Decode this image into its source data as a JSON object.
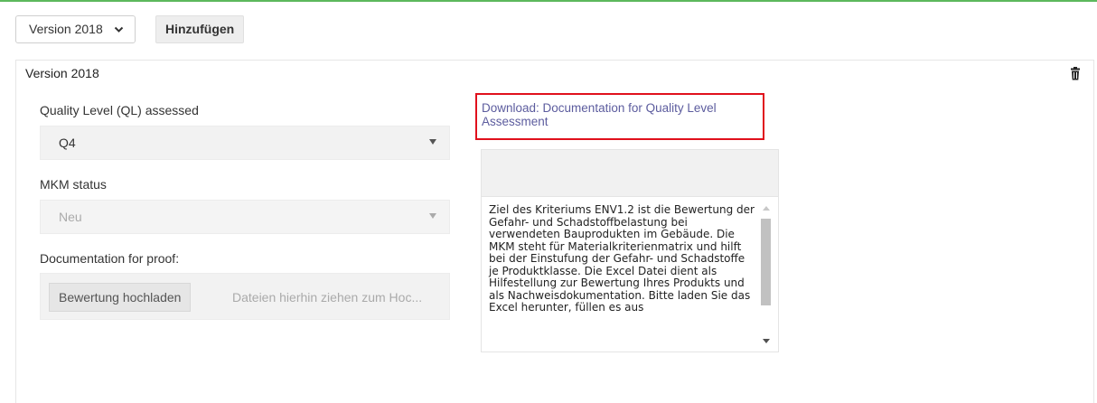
{
  "toolbar": {
    "version_select_value": "Version 2018",
    "add_button_label": "Hinzufügen"
  },
  "panel": {
    "title": "Version 2018",
    "quality_level": {
      "label": "Quality Level (QL) assessed",
      "value": "Q4"
    },
    "mkm_status": {
      "label": "MKM status",
      "value": "Neu"
    },
    "documentation": {
      "label": "Documentation for proof:",
      "upload_button_label": "Bewertung hochladen",
      "drop_hint": "Dateien hierhin ziehen zum Hoc..."
    },
    "download_link": "Download: Documentation for Quality Level Assessment",
    "info_text": "Ziel des Kriteriums ENV1.2 ist die Bewertung der Gefahr- und Schadstoffbelastung bei verwendeten Bauprodukten im Gebäude. Die MKM steht für Materialkriterienmatrix und hilft bei der Einstufung der Gefahr- und Schadstoffe je Produktklasse. Die Excel Datei dient als Hilfestellung zur Bewertung Ihres Produkts und als Nachweisdokumentation. Bitte laden Sie das Excel herunter, füllen es aus"
  },
  "colors": {
    "accent_rule": "#5cb85c",
    "highlight_border": "#e0101c",
    "link": "#5c5c9e"
  },
  "icons": {
    "select_chevron": "chevron-down-icon",
    "delete": "trash-icon"
  }
}
